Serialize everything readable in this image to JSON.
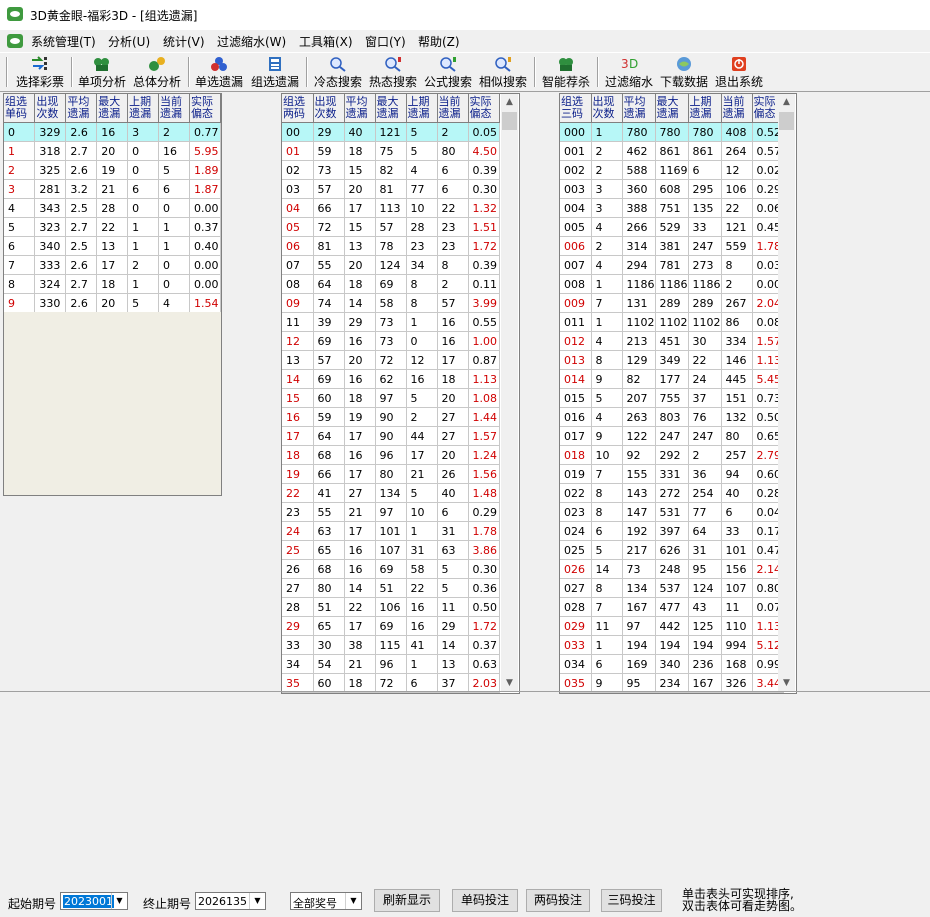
{
  "window": {
    "title": "3D黄金眼-福彩3D - [组选遗漏]"
  },
  "menu": [
    "系统管理(T)",
    "分析(U)",
    "统计(V)",
    "过滤缩水(W)",
    "工具箱(X)",
    "窗口(Y)",
    "帮助(Z)"
  ],
  "toolbar": [
    {
      "label": "选择彩票",
      "icon": "arrows-icon"
    },
    {
      "label": "单项分析",
      "icon": "analysis-icon"
    },
    {
      "label": "总体分析",
      "icon": "overall-icon"
    },
    {
      "label": "单选遗漏",
      "icon": "single-omit-icon"
    },
    {
      "label": "组选遗漏",
      "icon": "group-omit-icon"
    },
    {
      "label": "冷态搜索",
      "icon": "cold-search-icon"
    },
    {
      "label": "热态搜索",
      "icon": "hot-search-icon"
    },
    {
      "label": "公式搜索",
      "icon": "formula-search-icon"
    },
    {
      "label": "相似搜索",
      "icon": "similar-search-icon"
    },
    {
      "label": "智能荐杀",
      "icon": "smart-icon"
    },
    {
      "label": "过滤缩水",
      "icon": "filter-icon"
    },
    {
      "label": "下载数据",
      "icon": "download-icon"
    },
    {
      "label": "退出系统",
      "icon": "exit-icon"
    }
  ],
  "common_headers": [
    "出现次数",
    "平均遗漏",
    "最大遗漏",
    "上期遗漏",
    "当前遗漏",
    "实际偏态"
  ],
  "table1": {
    "first_header": "组选单码",
    "rows": [
      [
        "0",
        "329",
        "2.6",
        "16",
        "3",
        "2",
        "0.77"
      ],
      [
        "1",
        "318",
        "2.7",
        "20",
        "0",
        "16",
        "5.95"
      ],
      [
        "2",
        "325",
        "2.6",
        "19",
        "0",
        "5",
        "1.89"
      ],
      [
        "3",
        "281",
        "3.2",
        "21",
        "6",
        "6",
        "1.87"
      ],
      [
        "4",
        "343",
        "2.5",
        "28",
        "0",
        "0",
        "0.00"
      ],
      [
        "5",
        "323",
        "2.7",
        "22",
        "1",
        "1",
        "0.37"
      ],
      [
        "6",
        "340",
        "2.5",
        "13",
        "1",
        "1",
        "0.40"
      ],
      [
        "7",
        "333",
        "2.6",
        "17",
        "2",
        "0",
        "0.00"
      ],
      [
        "8",
        "324",
        "2.7",
        "18",
        "1",
        "0",
        "0.00"
      ],
      [
        "9",
        "330",
        "2.6",
        "20",
        "5",
        "4",
        "1.54"
      ]
    ]
  },
  "table2": {
    "first_header": "组选两码",
    "rows": [
      [
        "00",
        "29",
        "40",
        "121",
        "5",
        "2",
        "0.05"
      ],
      [
        "01",
        "59",
        "18",
        "75",
        "5",
        "80",
        "4.50"
      ],
      [
        "02",
        "73",
        "15",
        "82",
        "4",
        "6",
        "0.39"
      ],
      [
        "03",
        "57",
        "20",
        "81",
        "77",
        "6",
        "0.30"
      ],
      [
        "04",
        "66",
        "17",
        "113",
        "10",
        "22",
        "1.32"
      ],
      [
        "05",
        "72",
        "15",
        "57",
        "28",
        "23",
        "1.51"
      ],
      [
        "06",
        "81",
        "13",
        "78",
        "23",
        "23",
        "1.72"
      ],
      [
        "07",
        "55",
        "20",
        "124",
        "34",
        "8",
        "0.39"
      ],
      [
        "08",
        "64",
        "18",
        "69",
        "8",
        "2",
        "0.11"
      ],
      [
        "09",
        "74",
        "14",
        "58",
        "8",
        "57",
        "3.99"
      ],
      [
        "11",
        "39",
        "29",
        "73",
        "1",
        "16",
        "0.55"
      ],
      [
        "12",
        "69",
        "16",
        "73",
        "0",
        "16",
        "1.00"
      ],
      [
        "13",
        "57",
        "20",
        "72",
        "12",
        "17",
        "0.87"
      ],
      [
        "14",
        "69",
        "16",
        "62",
        "16",
        "18",
        "1.13"
      ],
      [
        "15",
        "60",
        "18",
        "97",
        "5",
        "20",
        "1.08"
      ],
      [
        "16",
        "59",
        "19",
        "90",
        "2",
        "27",
        "1.44"
      ],
      [
        "17",
        "64",
        "17",
        "90",
        "44",
        "27",
        "1.57"
      ],
      [
        "18",
        "68",
        "16",
        "96",
        "17",
        "20",
        "1.24"
      ],
      [
        "19",
        "66",
        "17",
        "80",
        "21",
        "26",
        "1.56"
      ],
      [
        "22",
        "41",
        "27",
        "134",
        "5",
        "40",
        "1.48"
      ],
      [
        "23",
        "55",
        "21",
        "97",
        "10",
        "6",
        "0.29"
      ],
      [
        "24",
        "63",
        "17",
        "101",
        "1",
        "31",
        "1.78"
      ],
      [
        "25",
        "65",
        "16",
        "107",
        "31",
        "63",
        "3.86"
      ],
      [
        "26",
        "68",
        "16",
        "69",
        "58",
        "5",
        "0.30"
      ],
      [
        "27",
        "80",
        "14",
        "51",
        "22",
        "5",
        "0.36"
      ],
      [
        "28",
        "51",
        "22",
        "106",
        "16",
        "11",
        "0.50"
      ],
      [
        "29",
        "65",
        "17",
        "69",
        "16",
        "29",
        "1.72"
      ],
      [
        "33",
        "30",
        "38",
        "115",
        "41",
        "14",
        "0.37"
      ],
      [
        "34",
        "54",
        "21",
        "96",
        "1",
        "13",
        "0.63"
      ],
      [
        "35",
        "60",
        "18",
        "72",
        "6",
        "37",
        "2.03"
      ]
    ]
  },
  "table3": {
    "first_header": "组选三码",
    "rows": [
      [
        "000",
        "1",
        "780",
        "780",
        "780",
        "408",
        "0.52"
      ],
      [
        "001",
        "2",
        "462",
        "861",
        "861",
        "264",
        "0.57"
      ],
      [
        "002",
        "2",
        "588",
        "1169",
        "6",
        "12",
        "0.02"
      ],
      [
        "003",
        "3",
        "360",
        "608",
        "295",
        "106",
        "0.29"
      ],
      [
        "004",
        "3",
        "388",
        "751",
        "135",
        "22",
        "0.06"
      ],
      [
        "005",
        "4",
        "266",
        "529",
        "33",
        "121",
        "0.45"
      ],
      [
        "006",
        "2",
        "314",
        "381",
        "247",
        "559",
        "1.78"
      ],
      [
        "007",
        "4",
        "294",
        "781",
        "273",
        "8",
        "0.03"
      ],
      [
        "008",
        "1",
        "1186",
        "1186",
        "1186",
        "2",
        "0.00"
      ],
      [
        "009",
        "7",
        "131",
        "289",
        "289",
        "267",
        "2.04"
      ],
      [
        "011",
        "1",
        "1102",
        "1102",
        "1102",
        "86",
        "0.08"
      ],
      [
        "012",
        "4",
        "213",
        "451",
        "30",
        "334",
        "1.57"
      ],
      [
        "013",
        "8",
        "129",
        "349",
        "22",
        "146",
        "1.13"
      ],
      [
        "014",
        "9",
        "82",
        "177",
        "24",
        "445",
        "5.45"
      ],
      [
        "015",
        "5",
        "207",
        "755",
        "37",
        "151",
        "0.73"
      ],
      [
        "016",
        "4",
        "263",
        "803",
        "76",
        "132",
        "0.50"
      ],
      [
        "017",
        "9",
        "122",
        "247",
        "247",
        "80",
        "0.65"
      ],
      [
        "018",
        "10",
        "92",
        "292",
        "2",
        "257",
        "2.79"
      ],
      [
        "019",
        "7",
        "155",
        "331",
        "36",
        "94",
        "0.60"
      ],
      [
        "022",
        "8",
        "143",
        "272",
        "254",
        "40",
        "0.28"
      ],
      [
        "023",
        "8",
        "147",
        "531",
        "77",
        "6",
        "0.04"
      ],
      [
        "024",
        "6",
        "192",
        "397",
        "64",
        "33",
        "0.17"
      ],
      [
        "025",
        "5",
        "217",
        "626",
        "31",
        "101",
        "0.47"
      ],
      [
        "026",
        "14",
        "73",
        "248",
        "95",
        "156",
        "2.14"
      ],
      [
        "027",
        "8",
        "134",
        "537",
        "124",
        "107",
        "0.80"
      ],
      [
        "028",
        "7",
        "167",
        "477",
        "43",
        "11",
        "0.07"
      ],
      [
        "029",
        "11",
        "97",
        "442",
        "125",
        "110",
        "1.13"
      ],
      [
        "033",
        "1",
        "194",
        "194",
        "194",
        "994",
        "5.12"
      ],
      [
        "034",
        "6",
        "169",
        "340",
        "236",
        "168",
        "0.99"
      ],
      [
        "035",
        "9",
        "95",
        "234",
        "167",
        "326",
        "3.44"
      ]
    ]
  },
  "bottom": {
    "start_label": "起始期号",
    "start_value": "2023001",
    "end_label": "终止期号",
    "end_value": "2026135",
    "award_value": "全部奖号",
    "refresh": "刷新显示",
    "single": "单码投注",
    "double": "两码投注",
    "triple": "三码投注",
    "hint1": "单击表头可实现排序,",
    "hint2": "双击表体可看走势图。"
  }
}
